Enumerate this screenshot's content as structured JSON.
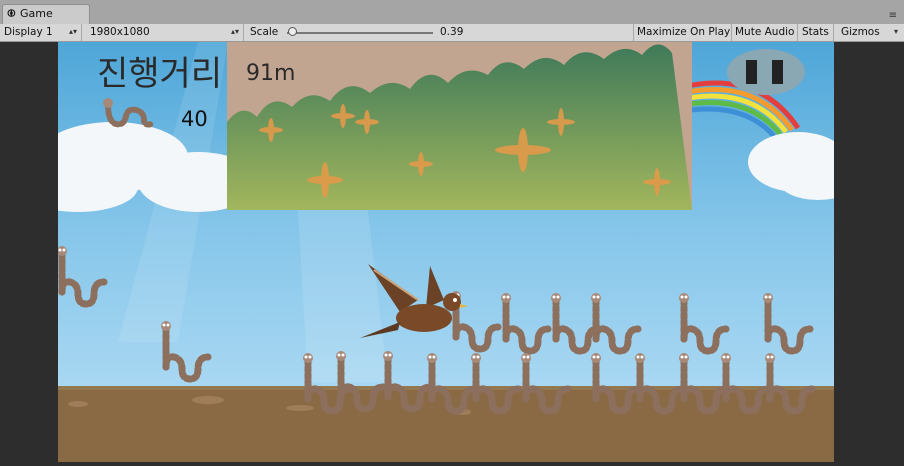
{
  "window": {
    "tab_title": "Game",
    "tab_icon": "unity-game-icon"
  },
  "toolbar": {
    "display": "Display 1",
    "resolution": "1980x1080",
    "scale_label": "Scale",
    "scale_value": "0.39",
    "scale_fraction": 0.04,
    "maximize_on_play": "Maximize On Play",
    "mute_audio": "Mute Audio",
    "stats": "Stats",
    "gizmos": "Gizmos"
  },
  "hud": {
    "distance_label": "진행거리",
    "distance_value": "91m",
    "worm_count": "40"
  }
}
